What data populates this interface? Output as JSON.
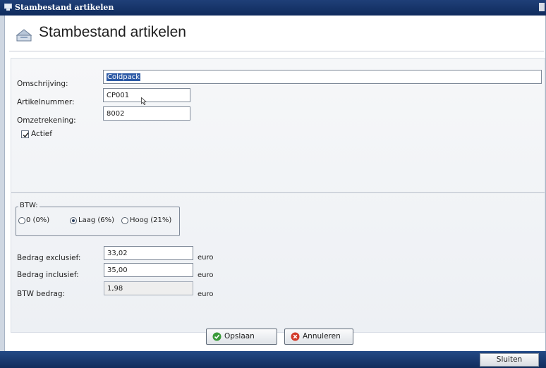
{
  "window": {
    "titlebar_text": "Stambestand artikelen",
    "title": "Stambestand artikelen"
  },
  "form": {
    "omschrijving_label": "Omschrijving:",
    "omschrijving_value": "Coldpack",
    "artikelnummer_label": "Artikelnummer:",
    "artikelnummer_value": "CP001",
    "omzetrekening_label": "Omzetrekening:",
    "omzetrekening_value": "8002",
    "actief_label": "Actief",
    "actief_checked": true
  },
  "btw": {
    "group_label": "BTW:",
    "options": [
      {
        "label": "0 (0%)",
        "selected": false
      },
      {
        "label": "Laag (6%)",
        "selected": true
      },
      {
        "label": "Hoog (21%)",
        "selected": false
      }
    ]
  },
  "amounts": {
    "exclusief_label": "Bedrag exclusief:",
    "exclusief_value": "33,02",
    "inclusief_label": "Bedrag inclusief:",
    "inclusief_value": "35,00",
    "btw_label": "BTW bedrag:",
    "btw_value": "1,98",
    "unit": "euro"
  },
  "buttons": {
    "save_label": "Opslaan",
    "cancel_label": "Annuleren",
    "close_label": "Sluiten"
  },
  "colors": {
    "titlebar": "#1f3f78",
    "selection": "#2d5aa6",
    "save_icon": "#3a9a3a",
    "cancel_icon": "#d23a2a"
  },
  "icons": {
    "titlebar": "window-app-icon",
    "header": "box-stack-icon",
    "save": "check-circle-icon",
    "cancel": "cancel-circle-icon"
  }
}
